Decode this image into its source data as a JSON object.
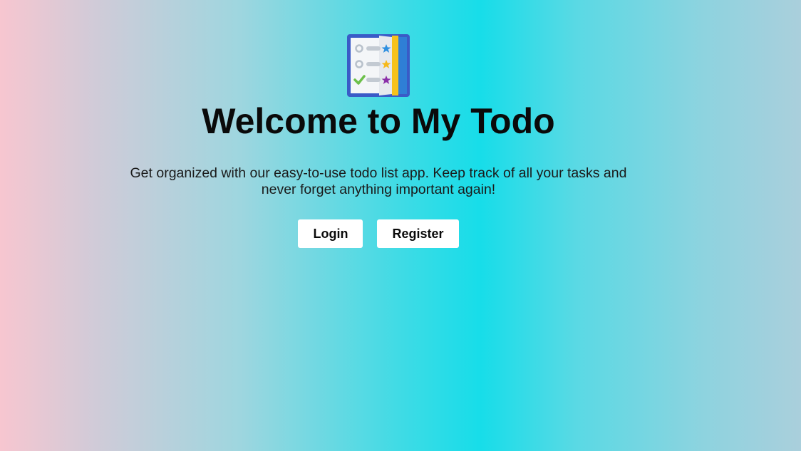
{
  "hero": {
    "logo_icon": "todo-list-icon",
    "title": "Welcome to My Todo",
    "description": "Get organized with our easy-to-use todo list app. Keep track of all your tasks and never forget anything important again!"
  },
  "actions": {
    "login_label": "Login",
    "register_label": "Register"
  },
  "colors": {
    "button_bg": "#ffffff",
    "text": "#0a0a0a"
  }
}
